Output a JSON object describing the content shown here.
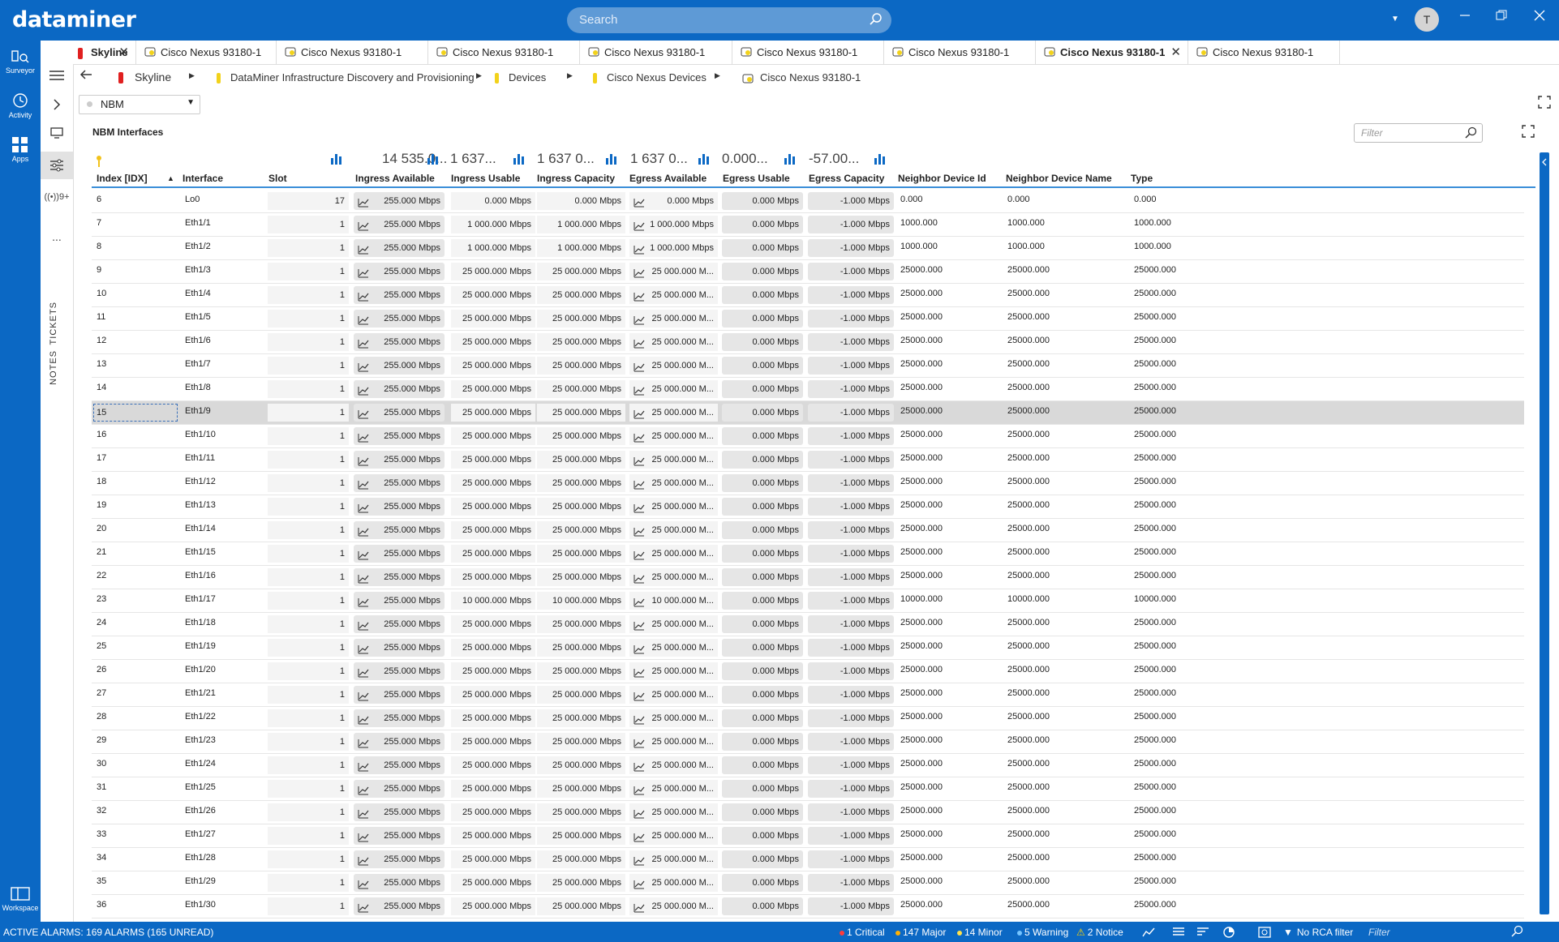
{
  "app": {
    "logo": "dataminer",
    "search_placeholder": "Search",
    "user_initial": "T"
  },
  "rail": [
    {
      "label": "Surveyor",
      "icon": "surveyor-icon"
    },
    {
      "label": "Activity",
      "icon": "activity-icon"
    },
    {
      "label": "Apps",
      "icon": "apps-icon"
    },
    {
      "label": "Workspace",
      "icon": "workspace-icon"
    }
  ],
  "rail2": {
    "tickets": "TICKETS",
    "notes": "NOTES",
    "alarm_count": "9+",
    "more": "..."
  },
  "tabs": [
    {
      "label": "Skyline",
      "type": "view",
      "closable": true
    },
    {
      "label": "Cisco Nexus 93180-1",
      "type": "element"
    },
    {
      "label": "Cisco Nexus 93180-1",
      "type": "element"
    },
    {
      "label": "Cisco Nexus 93180-1",
      "type": "element"
    },
    {
      "label": "Cisco Nexus 93180-1",
      "type": "element"
    },
    {
      "label": "Cisco Nexus 93180-1",
      "type": "element"
    },
    {
      "label": "Cisco Nexus 93180-1",
      "type": "element"
    },
    {
      "label": "Cisco Nexus 93180-1",
      "type": "element",
      "active": true,
      "closable": true
    },
    {
      "label": "Cisco Nexus 93180-1",
      "type": "element"
    }
  ],
  "breadcrumb": [
    "Skyline",
    "DataMiner Infrastructure Discovery and Provisioning",
    "Devices",
    "Cisco Nexus Devices",
    "Cisco Nexus 93180-1"
  ],
  "view_selector": {
    "value": "NBM"
  },
  "page_title": "NBM Interfaces",
  "filter_placeholder": "Filter",
  "summary": {
    "ingress_available": "14 535.0...",
    "ingress_usable": "1 637...",
    "ingress_capacity": "1 637 0...",
    "egress_available": "1 637 0...",
    "egress_usable": "0.000...",
    "egress_capacity": "-57.00..."
  },
  "columns": [
    "Index [IDX]",
    "Interface",
    "Slot",
    "Ingress Available",
    "Ingress Usable",
    "Ingress Capacity",
    "Egress Available",
    "Egress Usable",
    "Egress Capacity",
    "Neighbor Device Id",
    "Neighbor Device Name",
    "Type"
  ],
  "rows": [
    [
      "6",
      "Lo0",
      "17",
      "255.000 Mbps",
      "0.000 Mbps",
      "0.000 Mbps",
      "0.000 Mbps",
      "0.000 Mbps",
      "-1.000 Mbps",
      "0.000",
      "0.000",
      "0.000"
    ],
    [
      "7",
      "Eth1/1",
      "1",
      "255.000 Mbps",
      "1 000.000 Mbps",
      "1 000.000 Mbps",
      "1 000.000 Mbps",
      "0.000 Mbps",
      "-1.000 Mbps",
      "1000.000",
      "1000.000",
      "1000.000"
    ],
    [
      "8",
      "Eth1/2",
      "1",
      "255.000 Mbps",
      "1 000.000 Mbps",
      "1 000.000 Mbps",
      "1 000.000 Mbps",
      "0.000 Mbps",
      "-1.000 Mbps",
      "1000.000",
      "1000.000",
      "1000.000"
    ],
    [
      "9",
      "Eth1/3",
      "1",
      "255.000 Mbps",
      "25 000.000 Mbps",
      "25 000.000 Mbps",
      "25 000.000 M...",
      "0.000 Mbps",
      "-1.000 Mbps",
      "25000.000",
      "25000.000",
      "25000.000"
    ],
    [
      "10",
      "Eth1/4",
      "1",
      "255.000 Mbps",
      "25 000.000 Mbps",
      "25 000.000 Mbps",
      "25 000.000 M...",
      "0.000 Mbps",
      "-1.000 Mbps",
      "25000.000",
      "25000.000",
      "25000.000"
    ],
    [
      "11",
      "Eth1/5",
      "1",
      "255.000 Mbps",
      "25 000.000 Mbps",
      "25 000.000 Mbps",
      "25 000.000 M...",
      "0.000 Mbps",
      "-1.000 Mbps",
      "25000.000",
      "25000.000",
      "25000.000"
    ],
    [
      "12",
      "Eth1/6",
      "1",
      "255.000 Mbps",
      "25 000.000 Mbps",
      "25 000.000 Mbps",
      "25 000.000 M...",
      "0.000 Mbps",
      "-1.000 Mbps",
      "25000.000",
      "25000.000",
      "25000.000"
    ],
    [
      "13",
      "Eth1/7",
      "1",
      "255.000 Mbps",
      "25 000.000 Mbps",
      "25 000.000 Mbps",
      "25 000.000 M...",
      "0.000 Mbps",
      "-1.000 Mbps",
      "25000.000",
      "25000.000",
      "25000.000"
    ],
    [
      "14",
      "Eth1/8",
      "1",
      "255.000 Mbps",
      "25 000.000 Mbps",
      "25 000.000 Mbps",
      "25 000.000 M...",
      "0.000 Mbps",
      "-1.000 Mbps",
      "25000.000",
      "25000.000",
      "25000.000"
    ],
    [
      "15",
      "Eth1/9",
      "1",
      "255.000 Mbps",
      "25 000.000 Mbps",
      "25 000.000 Mbps",
      "25 000.000 M...",
      "0.000 Mbps",
      "-1.000 Mbps",
      "25000.000",
      "25000.000",
      "25000.000"
    ],
    [
      "16",
      "Eth1/10",
      "1",
      "255.000 Mbps",
      "25 000.000 Mbps",
      "25 000.000 Mbps",
      "25 000.000 M...",
      "0.000 Mbps",
      "-1.000 Mbps",
      "25000.000",
      "25000.000",
      "25000.000"
    ],
    [
      "17",
      "Eth1/11",
      "1",
      "255.000 Mbps",
      "25 000.000 Mbps",
      "25 000.000 Mbps",
      "25 000.000 M...",
      "0.000 Mbps",
      "-1.000 Mbps",
      "25000.000",
      "25000.000",
      "25000.000"
    ],
    [
      "18",
      "Eth1/12",
      "1",
      "255.000 Mbps",
      "25 000.000 Mbps",
      "25 000.000 Mbps",
      "25 000.000 M...",
      "0.000 Mbps",
      "-1.000 Mbps",
      "25000.000",
      "25000.000",
      "25000.000"
    ],
    [
      "19",
      "Eth1/13",
      "1",
      "255.000 Mbps",
      "25 000.000 Mbps",
      "25 000.000 Mbps",
      "25 000.000 M...",
      "0.000 Mbps",
      "-1.000 Mbps",
      "25000.000",
      "25000.000",
      "25000.000"
    ],
    [
      "20",
      "Eth1/14",
      "1",
      "255.000 Mbps",
      "25 000.000 Mbps",
      "25 000.000 Mbps",
      "25 000.000 M...",
      "0.000 Mbps",
      "-1.000 Mbps",
      "25000.000",
      "25000.000",
      "25000.000"
    ],
    [
      "21",
      "Eth1/15",
      "1",
      "255.000 Mbps",
      "25 000.000 Mbps",
      "25 000.000 Mbps",
      "25 000.000 M...",
      "0.000 Mbps",
      "-1.000 Mbps",
      "25000.000",
      "25000.000",
      "25000.000"
    ],
    [
      "22",
      "Eth1/16",
      "1",
      "255.000 Mbps",
      "25 000.000 Mbps",
      "25 000.000 Mbps",
      "25 000.000 M...",
      "0.000 Mbps",
      "-1.000 Mbps",
      "25000.000",
      "25000.000",
      "25000.000"
    ],
    [
      "23",
      "Eth1/17",
      "1",
      "255.000 Mbps",
      "10 000.000 Mbps",
      "10 000.000 Mbps",
      "10 000.000 M...",
      "0.000 Mbps",
      "-1.000 Mbps",
      "10000.000",
      "10000.000",
      "10000.000"
    ],
    [
      "24",
      "Eth1/18",
      "1",
      "255.000 Mbps",
      "25 000.000 Mbps",
      "25 000.000 Mbps",
      "25 000.000 M...",
      "0.000 Mbps",
      "-1.000 Mbps",
      "25000.000",
      "25000.000",
      "25000.000"
    ],
    [
      "25",
      "Eth1/19",
      "1",
      "255.000 Mbps",
      "25 000.000 Mbps",
      "25 000.000 Mbps",
      "25 000.000 M...",
      "0.000 Mbps",
      "-1.000 Mbps",
      "25000.000",
      "25000.000",
      "25000.000"
    ],
    [
      "26",
      "Eth1/20",
      "1",
      "255.000 Mbps",
      "25 000.000 Mbps",
      "25 000.000 Mbps",
      "25 000.000 M...",
      "0.000 Mbps",
      "-1.000 Mbps",
      "25000.000",
      "25000.000",
      "25000.000"
    ],
    [
      "27",
      "Eth1/21",
      "1",
      "255.000 Mbps",
      "25 000.000 Mbps",
      "25 000.000 Mbps",
      "25 000.000 M...",
      "0.000 Mbps",
      "-1.000 Mbps",
      "25000.000",
      "25000.000",
      "25000.000"
    ],
    [
      "28",
      "Eth1/22",
      "1",
      "255.000 Mbps",
      "25 000.000 Mbps",
      "25 000.000 Mbps",
      "25 000.000 M...",
      "0.000 Mbps",
      "-1.000 Mbps",
      "25000.000",
      "25000.000",
      "25000.000"
    ],
    [
      "29",
      "Eth1/23",
      "1",
      "255.000 Mbps",
      "25 000.000 Mbps",
      "25 000.000 Mbps",
      "25 000.000 M...",
      "0.000 Mbps",
      "-1.000 Mbps",
      "25000.000",
      "25000.000",
      "25000.000"
    ],
    [
      "30",
      "Eth1/24",
      "1",
      "255.000 Mbps",
      "25 000.000 Mbps",
      "25 000.000 Mbps",
      "25 000.000 M...",
      "0.000 Mbps",
      "-1.000 Mbps",
      "25000.000",
      "25000.000",
      "25000.000"
    ],
    [
      "31",
      "Eth1/25",
      "1",
      "255.000 Mbps",
      "25 000.000 Mbps",
      "25 000.000 Mbps",
      "25 000.000 M...",
      "0.000 Mbps",
      "-1.000 Mbps",
      "25000.000",
      "25000.000",
      "25000.000"
    ],
    [
      "32",
      "Eth1/26",
      "1",
      "255.000 Mbps",
      "25 000.000 Mbps",
      "25 000.000 Mbps",
      "25 000.000 M...",
      "0.000 Mbps",
      "-1.000 Mbps",
      "25000.000",
      "25000.000",
      "25000.000"
    ],
    [
      "33",
      "Eth1/27",
      "1",
      "255.000 Mbps",
      "25 000.000 Mbps",
      "25 000.000 Mbps",
      "25 000.000 M...",
      "0.000 Mbps",
      "-1.000 Mbps",
      "25000.000",
      "25000.000",
      "25000.000"
    ],
    [
      "34",
      "Eth1/28",
      "1",
      "255.000 Mbps",
      "25 000.000 Mbps",
      "25 000.000 Mbps",
      "25 000.000 M...",
      "0.000 Mbps",
      "-1.000 Mbps",
      "25000.000",
      "25000.000",
      "25000.000"
    ],
    [
      "35",
      "Eth1/29",
      "1",
      "255.000 Mbps",
      "25 000.000 Mbps",
      "25 000.000 Mbps",
      "25 000.000 M...",
      "0.000 Mbps",
      "-1.000 Mbps",
      "25000.000",
      "25000.000",
      "25000.000"
    ],
    [
      "36",
      "Eth1/30",
      "1",
      "255.000 Mbps",
      "25 000.000 Mbps",
      "25 000.000 Mbps",
      "25 000.000 M...",
      "0.000 Mbps",
      "-1.000 Mbps",
      "25000.000",
      "25000.000",
      "25000.000"
    ]
  ],
  "selected_row_index": "15",
  "status": {
    "alarms": "ACTIVE ALARMS: 169 ALARMS (165 UNREAD)",
    "critical": "1 Critical",
    "major": "147 Major",
    "minor": "14 Minor",
    "warning": "5 Warning",
    "notice": "2 Notice",
    "rca": "No RCA filter",
    "filter_placeholder": "Filter",
    "colors": {
      "critical": "#ff3b3b",
      "major": "#ffb000",
      "minor": "#ffe14a",
      "warning": "#74c4ff",
      "notice": "#ffd400"
    }
  },
  "colors": {
    "accent": "#0b68c4",
    "element_yellow": "#f2d21b",
    "view_red": "#e02020"
  }
}
